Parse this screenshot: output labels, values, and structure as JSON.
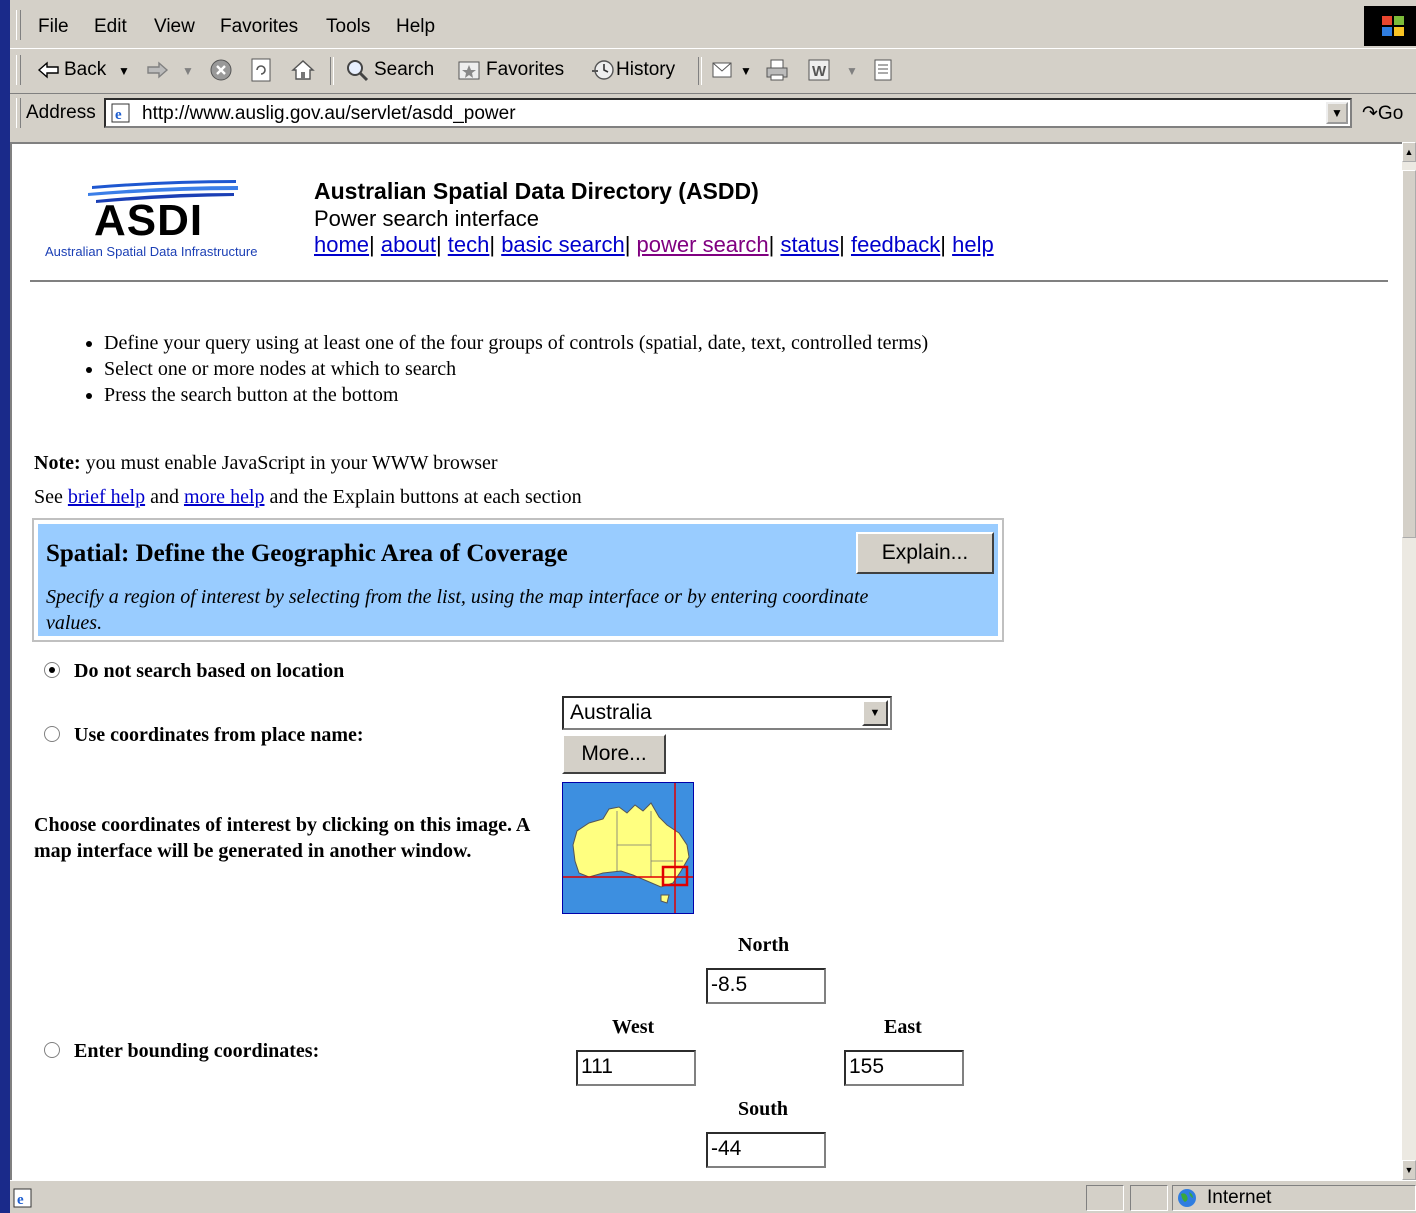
{
  "menu": [
    "File",
    "Edit",
    "View",
    "Favorites",
    "Tools",
    "Help"
  ],
  "toolbar": {
    "back": "Back",
    "search": "Search",
    "favorites": "Favorites",
    "history": "History"
  },
  "address": {
    "label": "Address",
    "url": "http://www.auslig.gov.au/servlet/asdd_power",
    "go": "Go"
  },
  "logo": {
    "text": "ASDI",
    "subtitle": "Australian Spatial Data Infrastructure"
  },
  "header": {
    "title": "Australian Spatial Data Directory (ASDD)",
    "subtitle": "Power search interface",
    "nav": [
      "home",
      "about",
      "tech",
      "basic search",
      "power search",
      "status",
      "feedback",
      "help"
    ]
  },
  "instructions": [
    "Define your query using at least one of the four groups of controls (spatial, date, text, controlled terms)",
    "Select one or more nodes at which to search",
    "Press the search button at the bottom"
  ],
  "note": {
    "label": "Note:",
    "text": " you must enable JavaScript in your WWW browser"
  },
  "see_help": {
    "pre": "See ",
    "brief": "brief help",
    "mid": " and ",
    "more": "more help",
    "post": " and the Explain buttons at each section"
  },
  "spatial": {
    "title": "Spatial: Define the Geographic Area of Coverage",
    "explain_label": "Explain...",
    "description": "Specify a region of interest by selecting from the list, using the map interface or by entering coordinate values.",
    "opt_none": "Do not search based on location",
    "opt_place": "Use coordinates from place name:",
    "place_selected": "Australia",
    "more_label": "More...",
    "map_instructions": "Choose coordinates of interest by clicking on this image. A map interface will be generated in another window.",
    "opt_bounding": "Enter bounding coordinates:",
    "north_label": "North",
    "north_value": "-8.5",
    "west_label": "West",
    "west_value": "111",
    "east_label": "East",
    "east_value": "155",
    "south_label": "South",
    "south_value": "-44"
  },
  "status": {
    "zone": "Internet"
  },
  "colors": {
    "spatial_bg": "#99ccff",
    "link": "#0000cc",
    "visited": "#800080"
  }
}
